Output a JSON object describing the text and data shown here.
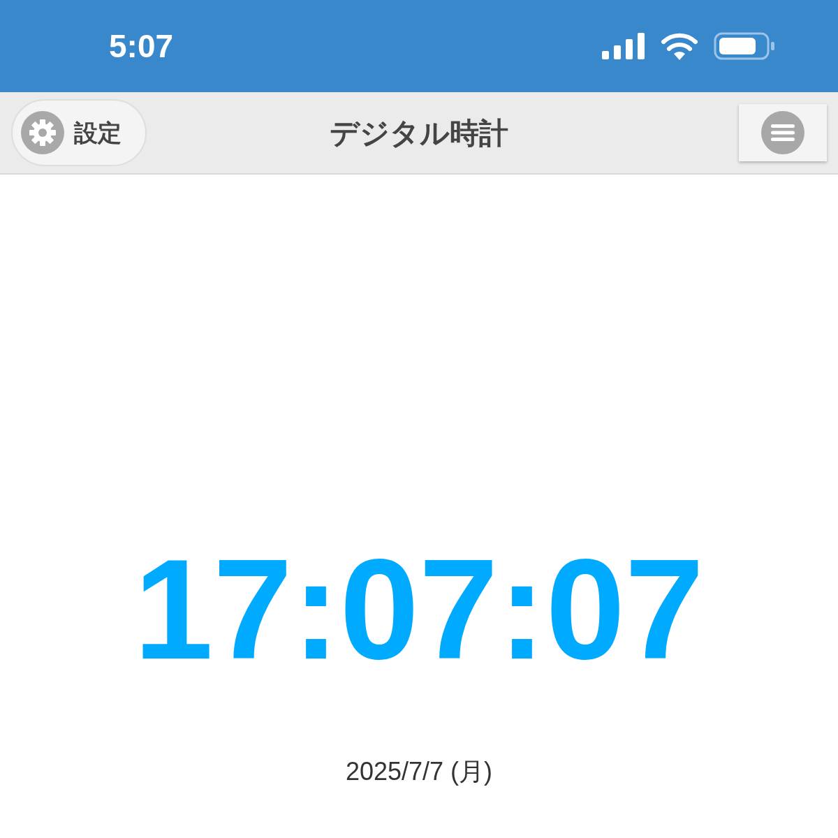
{
  "status_bar": {
    "time": "5:07"
  },
  "header": {
    "settings_button": "設定",
    "title": "デジタル時計"
  },
  "clock": {
    "time": "17:07:07",
    "date": "2025/7/7 (月)"
  }
}
